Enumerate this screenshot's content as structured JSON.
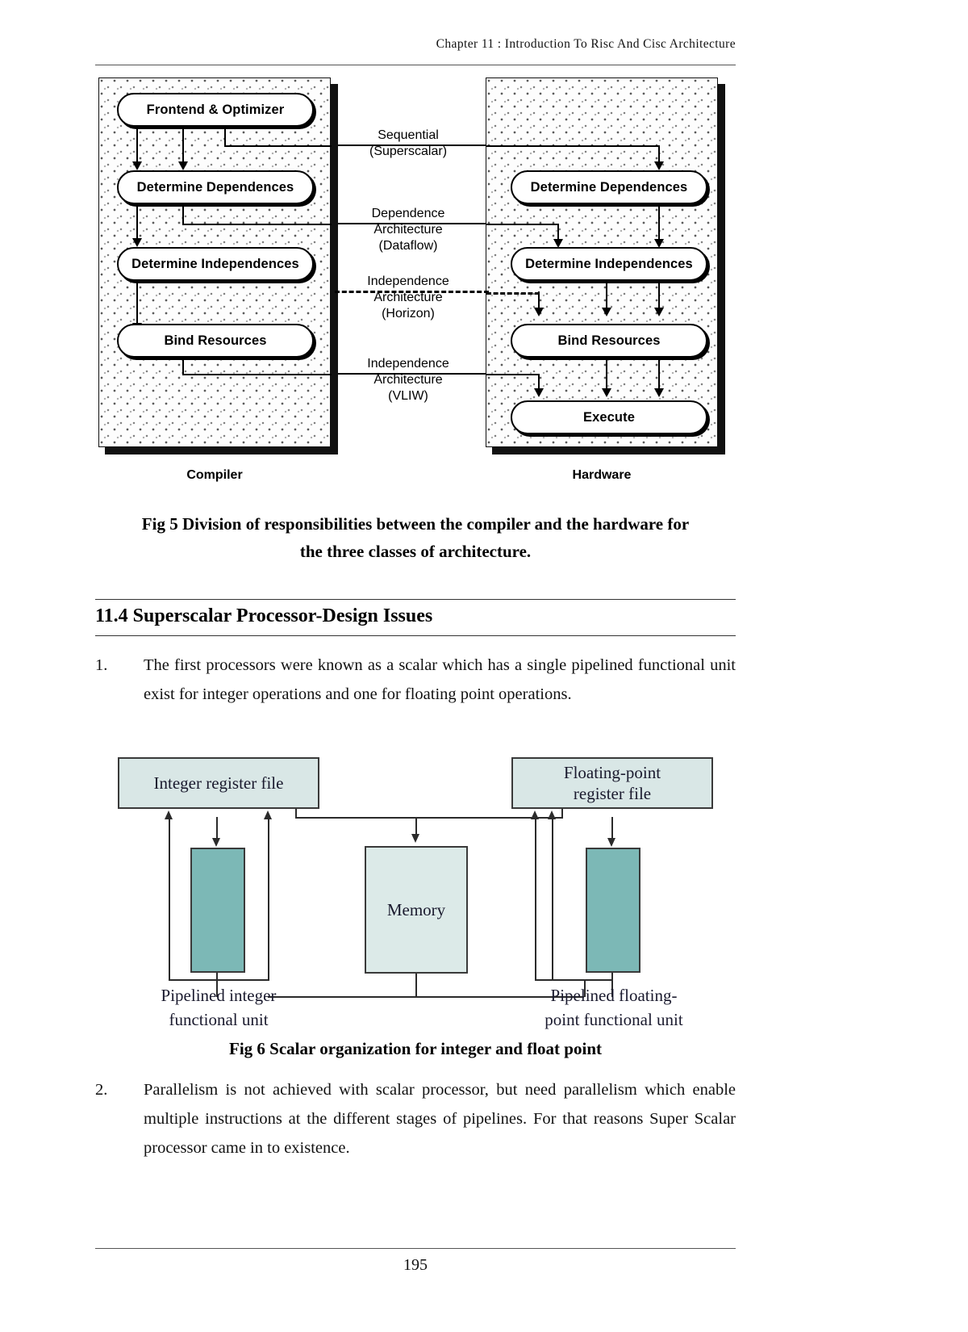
{
  "header": {
    "chapter_title": "Chapter  11 : Introduction To Risc And Cisc Architecture"
  },
  "figure5": {
    "left_panel": {
      "caption": "Compiler",
      "nodes": [
        {
          "label": "Frontend & Optimizer"
        },
        {
          "label": "Determine Dependences"
        },
        {
          "label": "Determine Independences"
        },
        {
          "label": "Bind Resources"
        }
      ]
    },
    "right_panel": {
      "caption": "Hardware",
      "nodes": [
        {
          "label": "Determine Dependences"
        },
        {
          "label": "Determine Independences"
        },
        {
          "label": "Bind Resources"
        },
        {
          "label": "Execute"
        }
      ]
    },
    "middle_labels": [
      {
        "line1": "Sequential",
        "line2": "(Superscalar)",
        "line3": ""
      },
      {
        "line1": "Dependence",
        "line2": "Architecture",
        "line3": "(Dataflow)"
      },
      {
        "line1": "Independence",
        "line2": "Architecture",
        "line3": "(Horizon)"
      },
      {
        "line1": "Independence",
        "line2": "Architecture",
        "line3": "(VLIW)"
      }
    ],
    "caption_line1": "Fig 5 Division of responsibilities between the compiler and the hardware for",
    "caption_line2": "the three classes of architecture."
  },
  "section": {
    "heading": "11.4 Superscalar Processor-Design Issues"
  },
  "list": [
    {
      "number": "1.",
      "text": "The first processors were known as a scalar which has a single pipelined functional unit exist for integer operations and one for floating point operations."
    },
    {
      "number": "2.",
      "text": "Parallelism is not achieved with scalar processor, but need parallelism which enable multiple instructions at the different stages of pipelines. For that reasons Super Scalar processor came in to existence."
    }
  ],
  "figure6": {
    "integer_register_file": "Integer register file",
    "floating_register_file_line1": "Floating-point",
    "floating_register_file_line2": "register file",
    "memory": "Memory",
    "integer_unit_label_line1": "Pipelined integer",
    "integer_unit_label_line2": "functional unit",
    "float_unit_label_line1": "Pipelined floating-",
    "float_unit_label_line2": "point functional unit",
    "caption": "Fig 6 Scalar organization for integer and float point",
    "colors": {
      "register_file_fill": "#d9e7e6",
      "functional_unit_fill": "#7cb8b6",
      "memory_fill": "#dceae8",
      "stroke": "#3a3a3a"
    }
  },
  "footer": {
    "page_number": "195"
  }
}
